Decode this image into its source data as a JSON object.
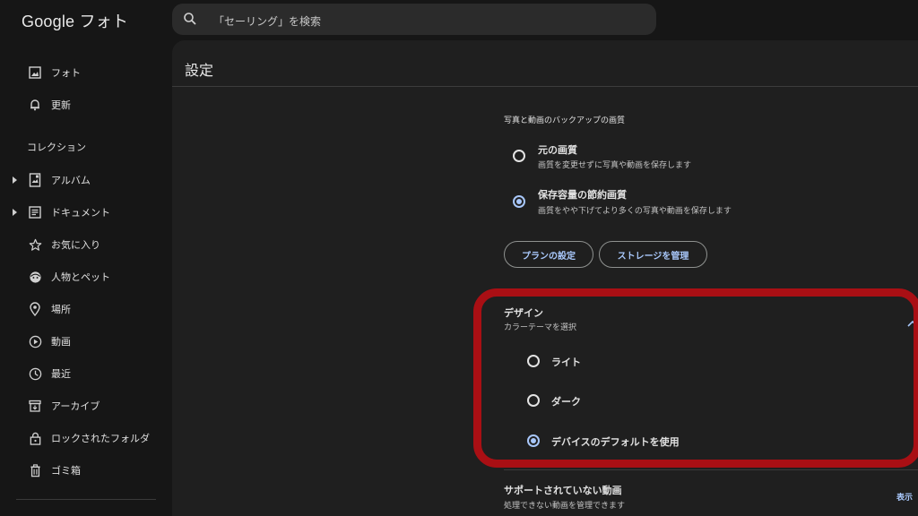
{
  "app": {
    "logo_text": "Google フォト"
  },
  "search": {
    "placeholder": "「セーリング」を検索"
  },
  "sidebar": {
    "collections_title": "コレクション",
    "items": [
      {
        "label": "フォト",
        "icon": "photo-icon"
      },
      {
        "label": "更新",
        "icon": "bell-icon"
      },
      {
        "label": "アルバム",
        "icon": "album-icon"
      },
      {
        "label": "ドキュメント",
        "icon": "document-icon"
      },
      {
        "label": "お気に入り",
        "icon": "star-icon"
      },
      {
        "label": "人物とペット",
        "icon": "face-icon"
      },
      {
        "label": "場所",
        "icon": "location-pin-icon"
      },
      {
        "label": "動画",
        "icon": "play-circle-icon"
      },
      {
        "label": "最近",
        "icon": "clock-icon"
      },
      {
        "label": "アーカイブ",
        "icon": "archive-icon"
      },
      {
        "label": "ロックされたフォルダ",
        "icon": "lock-icon"
      },
      {
        "label": "ゴミ箱",
        "icon": "trash-icon"
      }
    ]
  },
  "main": {
    "title": "設定",
    "backup": {
      "heading": "写真と動画のバックアップの画質",
      "options": [
        {
          "title": "元の画質",
          "desc": "画質を変更せずに写真や動画を保存します",
          "selected": false
        },
        {
          "title": "保存容量の節約画質",
          "desc": "画質をやや下げてより多くの写真や動画を保存します",
          "selected": true
        }
      ],
      "plan_button": "プランの設定",
      "storage_button": "ストレージを管理"
    },
    "design": {
      "title": "デザイン",
      "subtitle": "カラーテーマを選択",
      "options": [
        {
          "label": "ライト",
          "selected": false
        },
        {
          "label": "ダーク",
          "selected": false
        },
        {
          "label": "デバイスのデフォルトを使用",
          "selected": true
        }
      ]
    },
    "unsupported": {
      "title": "サポートされていない動画",
      "desc": "処理できない動画を管理できます",
      "show_link": "表示"
    }
  },
  "colors": {
    "accent": "#a8c7fa",
    "highlight": "#a90f14",
    "background": "#1f1f1f"
  }
}
